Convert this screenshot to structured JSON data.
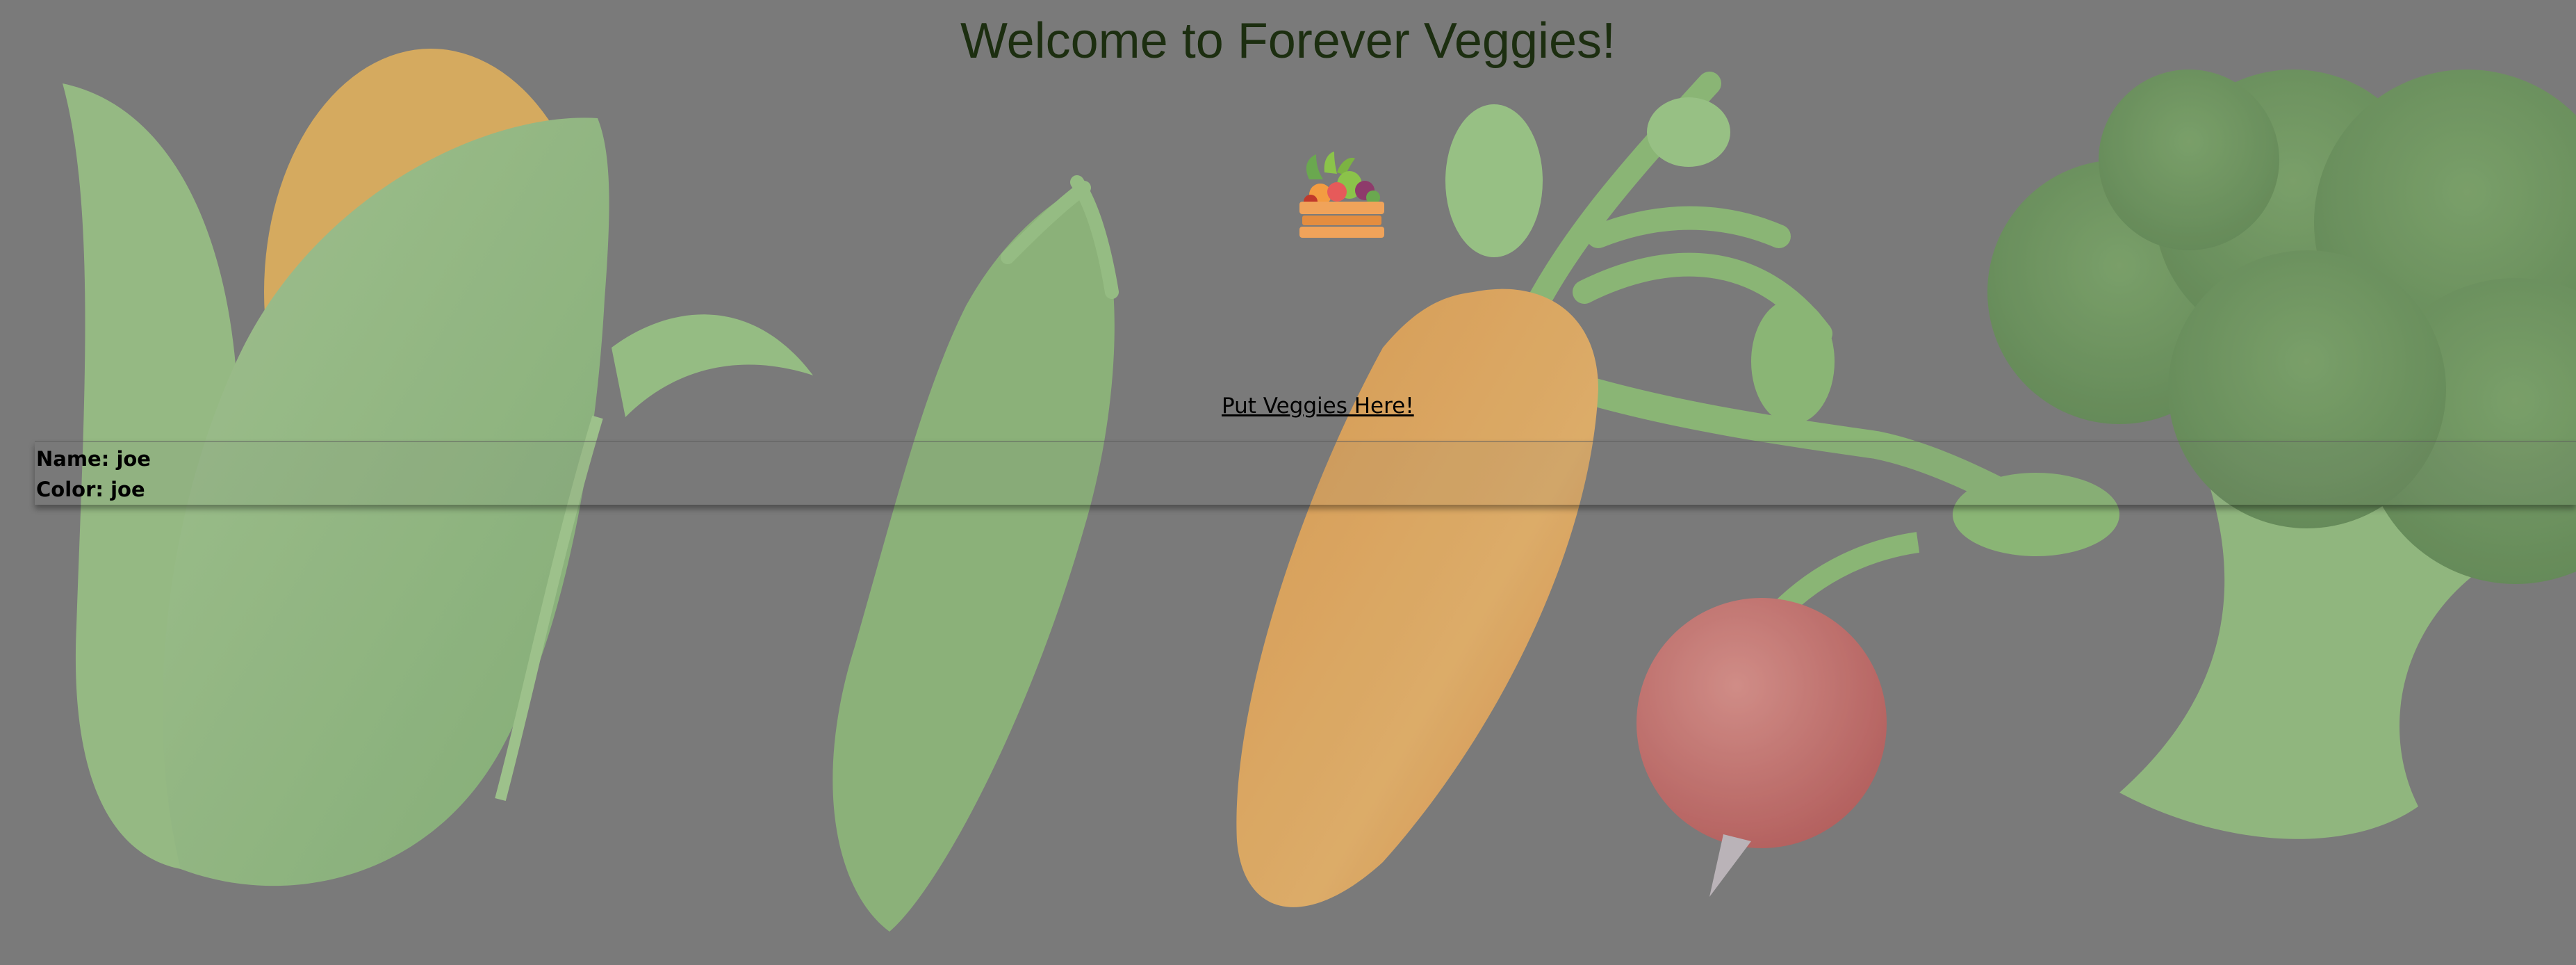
{
  "page": {
    "title": "Welcome to Forever Veggies!",
    "logo_icon": "veggie-crate-icon",
    "link_label": "Put Veggies Here!"
  },
  "record": {
    "name_label": "Name:",
    "name_value": "joe",
    "color_label": "Color:",
    "color_value": "joe"
  },
  "colors": {
    "title": "#1c2e10",
    "background": "#7a7a7a"
  },
  "background_icons": [
    "corn-icon",
    "pea-pod-icon",
    "carrot-icon",
    "radish-icon",
    "broccoli-icon"
  ]
}
